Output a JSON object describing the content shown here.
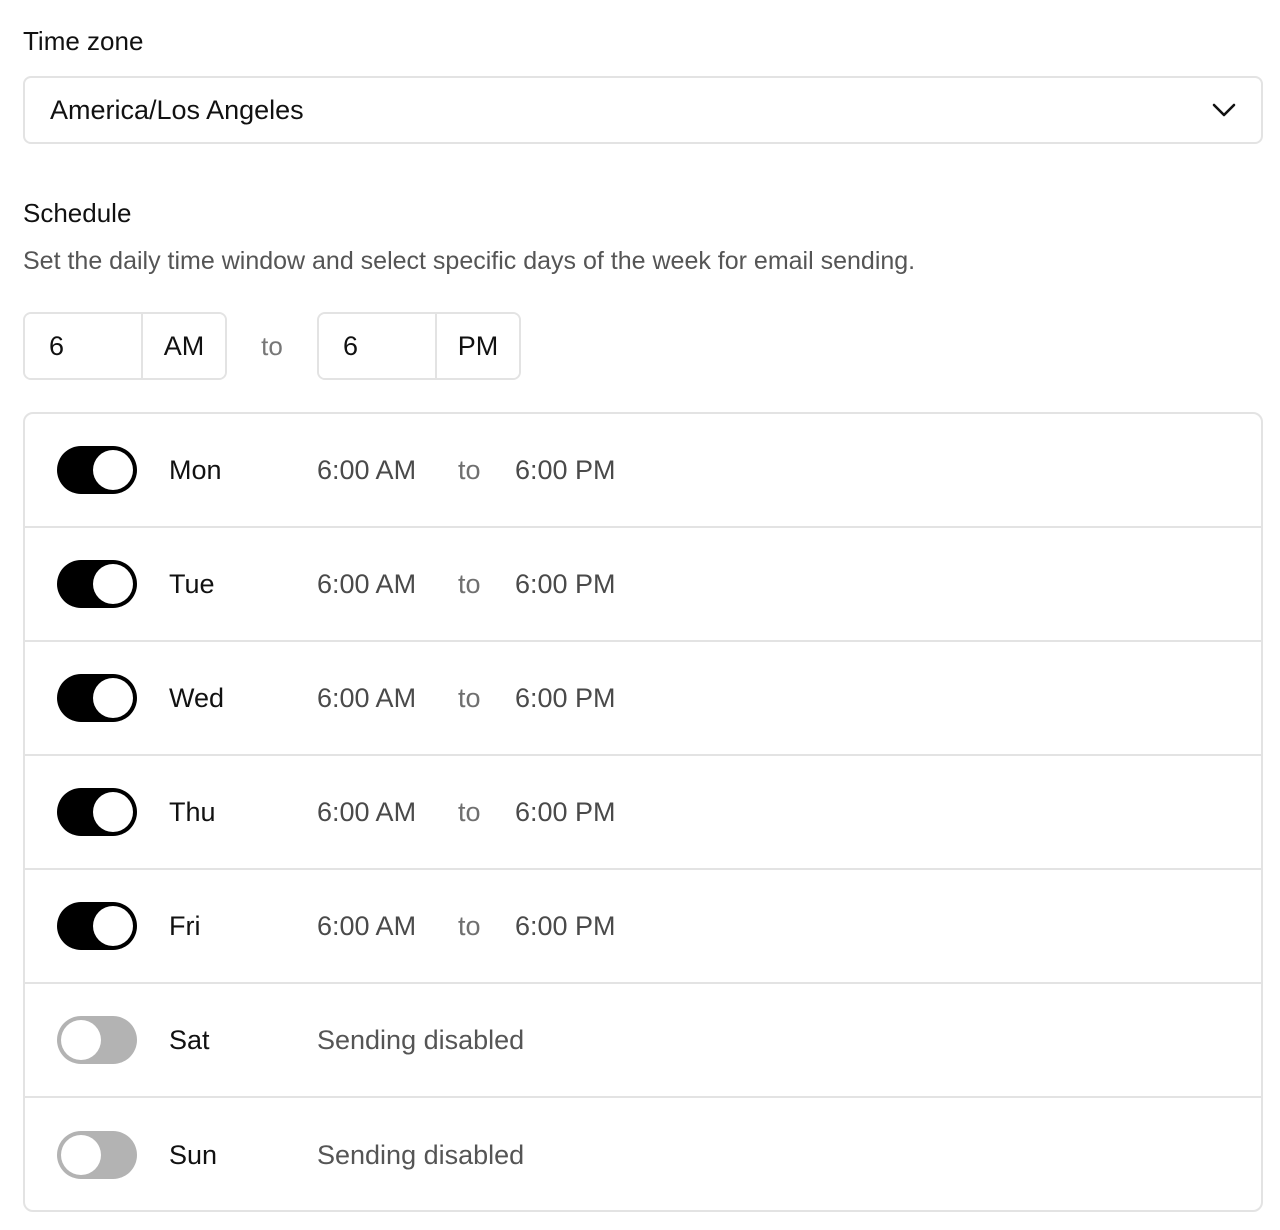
{
  "timezone": {
    "label": "Time zone",
    "value": "America/Los Angeles",
    "icon": "chevron-down-icon"
  },
  "schedule": {
    "title": "Schedule",
    "description": "Set the daily time window and select specific days of the week for email sending.",
    "start": {
      "hour": "6",
      "period": "AM"
    },
    "separator": "to",
    "end": {
      "hour": "6",
      "period": "PM"
    }
  },
  "colors": {
    "toggle_on": "#000000",
    "toggle_off": "#b3b3b3",
    "border": "#e3e3e3"
  },
  "days": [
    {
      "name": "Mon",
      "enabled": true,
      "start": "6:00 AM",
      "sep": "to",
      "end": "6:00 PM"
    },
    {
      "name": "Tue",
      "enabled": true,
      "start": "6:00 AM",
      "sep": "to",
      "end": "6:00 PM"
    },
    {
      "name": "Wed",
      "enabled": true,
      "start": "6:00 AM",
      "sep": "to",
      "end": "6:00 PM"
    },
    {
      "name": "Thu",
      "enabled": true,
      "start": "6:00 AM",
      "sep": "to",
      "end": "6:00 PM"
    },
    {
      "name": "Fri",
      "enabled": true,
      "start": "6:00 AM",
      "sep": "to",
      "end": "6:00 PM"
    },
    {
      "name": "Sat",
      "enabled": false,
      "status": "Sending disabled"
    },
    {
      "name": "Sun",
      "enabled": false,
      "status": "Sending disabled"
    }
  ]
}
